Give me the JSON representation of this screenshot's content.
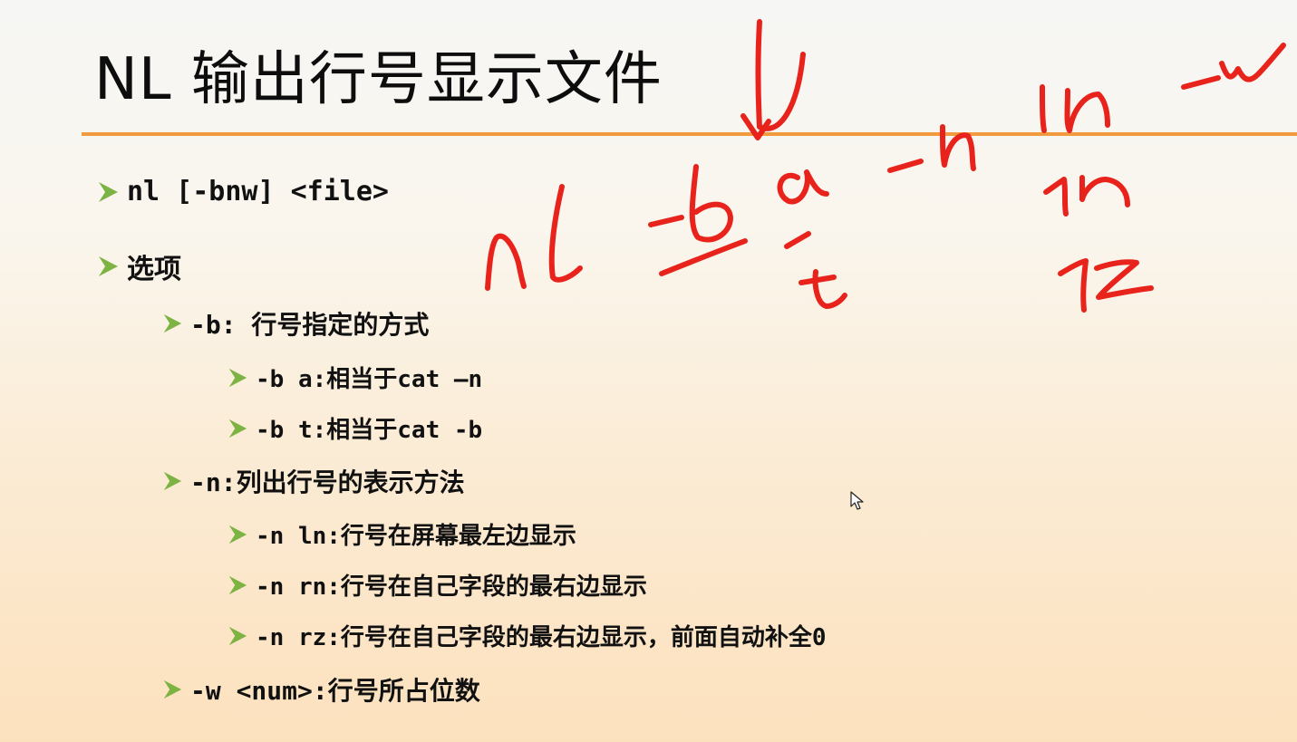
{
  "slide": {
    "title": "NL 输出行号显示文件",
    "syntax": "nl [-bnw] <file>",
    "options_heading": "选项",
    "b_option": {
      "label": "-b: 行号指定的方式",
      "sub": [
        "-b a:相当于cat —n",
        "-b t:相当于cat -b"
      ]
    },
    "n_option": {
      "label": "-n:列出行号的表示方法",
      "sub": [
        "-n ln:行号在屏幕最左边显示",
        "-n rn:行号在自己字段的最右边显示",
        "-n rz:行号在自己字段的最右边显示，前面自动补全0"
      ]
    },
    "w_option": {
      "label": "-w <num>:行号所占位数"
    }
  },
  "colors": {
    "accent_rule": "#f19a3e",
    "bullet": "#7cb342",
    "ink": "#e8231c"
  }
}
